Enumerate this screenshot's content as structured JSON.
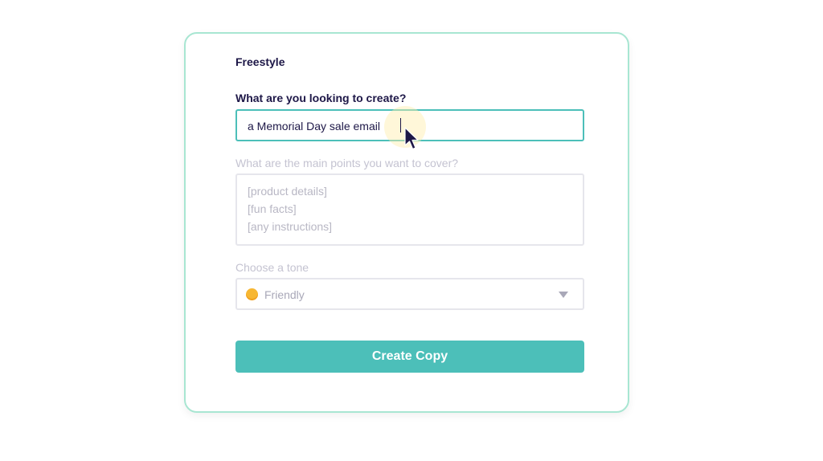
{
  "form": {
    "title": "Freestyle",
    "create_label": "What are you looking to create?",
    "create_value": "a Memorial Day sale email",
    "points_label": "What are the main points you want to cover?",
    "points_placeholder_lines": [
      "[product details]",
      "[fun facts]",
      "[any instructions]"
    ],
    "tone_label": "Choose a tone",
    "tone_value": "Friendly",
    "tone_icon": "smiley-emoji-icon",
    "submit_label": "Create Copy"
  },
  "colors": {
    "accent": "#4cbfb9",
    "card_border": "#a8e6d2",
    "text_dark": "#1d1747",
    "text_muted": "#c4c3d1"
  }
}
